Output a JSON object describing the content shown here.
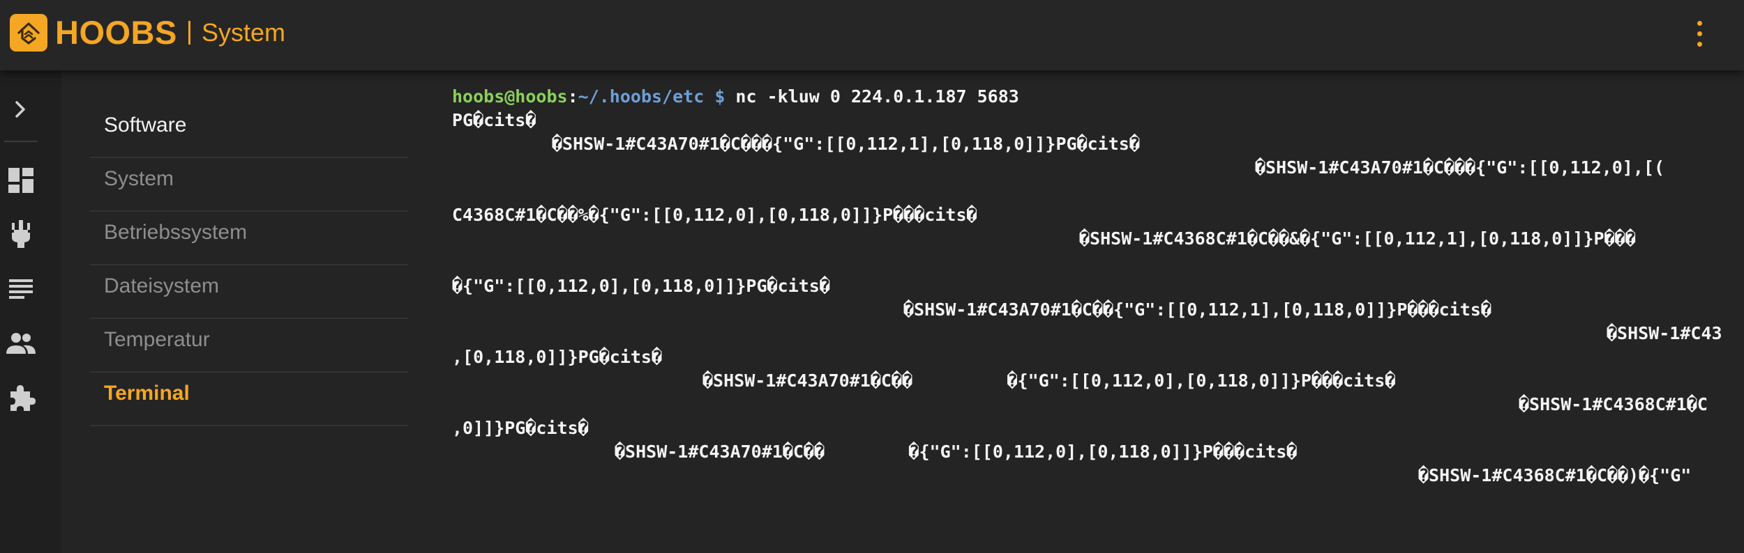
{
  "header": {
    "brand": "HOOBS",
    "section": "System",
    "brand_color": "#f5a623",
    "logo_icon": "hoobs-logo-icon",
    "menu_icon": "kebab-menu-icon"
  },
  "rail": {
    "items": [
      {
        "name": "expand-chevron-icon"
      },
      {
        "name": "dashboard-icon"
      },
      {
        "name": "accessories-plug-icon"
      },
      {
        "name": "log-list-icon"
      },
      {
        "name": "users-icon"
      },
      {
        "name": "plugins-puzzle-icon"
      }
    ]
  },
  "menu": {
    "items": [
      {
        "label": "Software"
      },
      {
        "label": "System"
      },
      {
        "label": "Betriebssystem"
      },
      {
        "label": "Dateisystem"
      },
      {
        "label": "Temperatur"
      },
      {
        "label": "Terminal"
      }
    ]
  },
  "terminal": {
    "prompt_user": "hoobs@hoobs",
    "prompt_sep": ":",
    "prompt_path": "~/.hoobs/etc",
    "prompt_symbol": " $ ",
    "command": "nc -kluw 0 224.0.1.187 5683",
    "output": [
      "PG�cits�",
      "�SHSW-1#C43A70#1�C���{\"G\":[[0,112,1],[0,118,0]]}PG�cits�",
      "�SHSW-1#C43A70#1�C���{\"G\":[[0,112,0],[(",
      "C4368C#1�C��%�{\"G\":[[0,112,0],[0,118,0]]}P���cits�",
      "�SHSW-1#C4368C#1�C��&�{\"G\":[[0,112,1],[0,118,0]]}P���",
      "�{\"G\":[[0,112,0],[0,118,0]]}PG�cits�",
      "�SHSW-1#C43A70#1�C��{\"G\":[[0,112,1],[0,118,0]]}P���cits�",
      "�SHSW-1#C43",
      ",[0,118,0]]}PG�cits�",
      "�SHSW-1#C43A70#1�C��         �{\"G\":[[0,112,0],[0,118,0]]}P���cits�",
      "�SHSW-1#C4368C#1�C",
      ",0]]}PG�cits�",
      "�SHSW-1#C43A70#1�C��        �{\"G\":[[0,112,0],[0,118,0]]}P���cits�",
      "�SHSW-1#C4368C#1�C��)�{\"G\""
    ]
  }
}
